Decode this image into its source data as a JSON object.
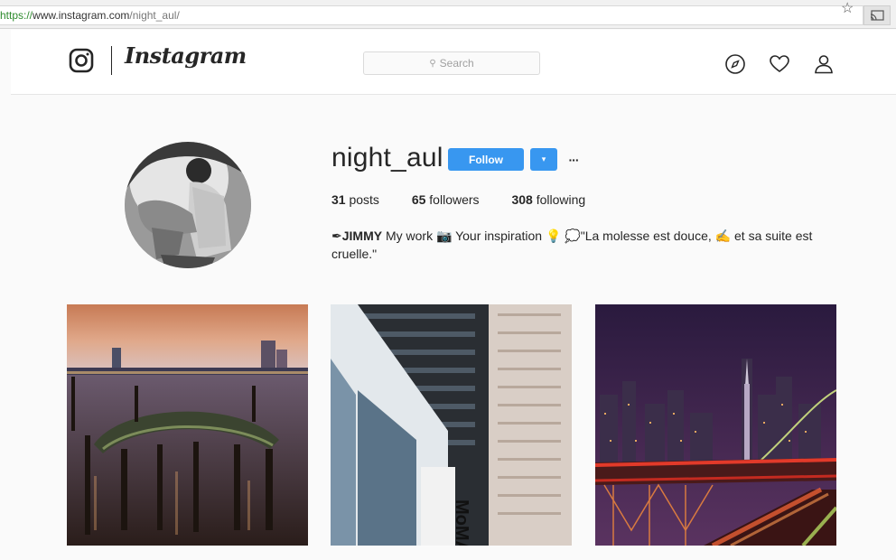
{
  "browser": {
    "url_scheme": "https://",
    "url_host": "www.instagram.com",
    "url_path": "/night_aul/",
    "star_icon": "star-icon",
    "cast_icon": "cast-icon"
  },
  "nav": {
    "wordmark": "Instagram",
    "search_placeholder": "Search",
    "icons": [
      "instagram-camera-icon",
      "compass-icon",
      "heart-icon",
      "person-icon"
    ]
  },
  "profile": {
    "username": "night_aul",
    "follow_label": "Follow",
    "dropdown_glyph": "▾",
    "more_glyph": "···",
    "stats": {
      "posts_count": "31",
      "posts_label": "posts",
      "followers_count": "65",
      "followers_label": "followers",
      "following_count": "308",
      "following_label": "following"
    },
    "bio": {
      "prefix_emoji": "✒",
      "name": "JIMMY",
      "text_1": "My work",
      "camera_emoji": "📷",
      "text_2": "Your inspiration",
      "bulb_emoji": "💡",
      "speech_emoji": "💭",
      "text_3": "\"La molesse est douce,",
      "pencil_emoji": "✍",
      "text_4": "et sa suite est cruelle.\""
    }
  },
  "posts": [
    {
      "subject": "harbor-pier-night"
    },
    {
      "subject": "skyscrapers-moma"
    },
    {
      "subject": "bridge-city-night"
    }
  ],
  "colors": {
    "follow_blue": "#3897f0",
    "text": "#262626",
    "background": "#fafafa"
  }
}
